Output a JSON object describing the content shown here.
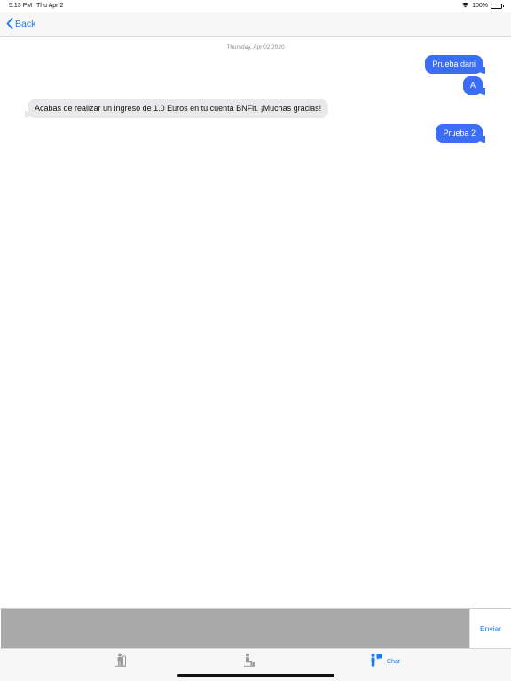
{
  "status_bar": {
    "time": "5:13 PM",
    "date": "Thu Apr 2",
    "battery_text": "100%",
    "icons": [
      "wifi-icon",
      "battery-icon"
    ]
  },
  "nav": {
    "back_label": "Back",
    "back_icon": "chevron-left-icon"
  },
  "chat": {
    "date_header": "Thursday, Apr 02 2020",
    "messages": [
      {
        "direction": "outgoing",
        "text": "Prueba dani"
      },
      {
        "direction": "outgoing",
        "text": "A"
      },
      {
        "direction": "incoming",
        "text": "Acabas de realizar un ingreso de 1.0 Euros en tu cuenta BNFit. ¡Muchas gracias!"
      },
      {
        "direction": "outgoing",
        "text": "Prueba 2"
      }
    ]
  },
  "composer": {
    "input_value": "",
    "send_label": "Enviar"
  },
  "tab_bar": {
    "tabs": [
      {
        "label": "",
        "icon": "person-standing-icon",
        "selected": false
      },
      {
        "label": "",
        "icon": "person-sitting-icon",
        "selected": false
      },
      {
        "label": "Chat",
        "icon": "chat-person-icon",
        "selected": true
      }
    ]
  },
  "colors": {
    "accent": "#1a7cf6",
    "outgoing_bubble": "#3b6ef5",
    "incoming_bubble": "#e9e9eb",
    "input_background": "#a9a9a9"
  }
}
